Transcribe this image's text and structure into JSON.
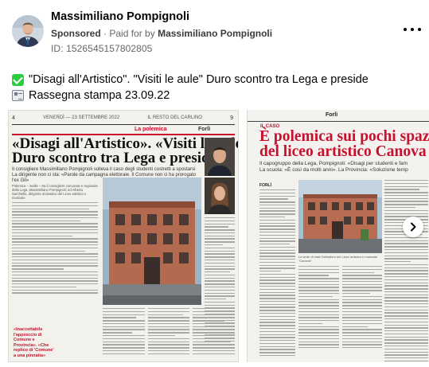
{
  "post": {
    "author": "Massimiliano Pompignoli",
    "sponsored_label": "Sponsored",
    "separator": "·",
    "paid_for_label": "Paid for by",
    "paid_for_name": "Massimiliano Pompignoli",
    "id_label": "ID:",
    "id_value": "1526545157802805",
    "more_icon": "ellipsis-icon",
    "text_line1": "\"Disagi all'Artistico\". \"Visiti le aule\" Duro scontro tra Lega e preside",
    "text_line2": "Rassegna stampa 23.09.22",
    "line1_icon": "check-mark-emoji-icon",
    "line2_icon": "newspaper-emoji-icon"
  },
  "carousel": {
    "next_icon": "chevron-right-icon",
    "card1": {
      "page_number": "4",
      "masthead_date": "VENERDÌ — 23 SETTEMBRE 2022",
      "masthead_paper": "IL RESTO DEL CARLINO",
      "page_corner": "9",
      "section": "La polemica",
      "city": "Forlì",
      "headline_line1": "«Disagi all'Artistico». «Visiti le aule»",
      "headline_line2": "Duro scontro tra Lega e preside",
      "subhead_line1": "Il consigliere Massimiliano Pompignoli sollevа il caso degli studenti costretti a spostarsi",
      "subhead_line2": "La dirigente non ci sta: «Parole da campagna elettorale. Il Comune non ci ha prorogato l'ex Gil»",
      "body_intro": "Polemica – inutile – tra il consigliere comunale e regionale della Lega, Massimiliano Pompignoli, ed Alberta Sarchiello, dirigente scolastico del Liceo artistico e musicale.",
      "pull_quote": "«Inaccettabile l'approccio di Comune e Provincia». «Che replico di 'Comune' a una pinnatia»"
    },
    "card2": {
      "city": "Forlì",
      "section": "IL CASO",
      "headline_line1": "È polemica sui pochi spaz",
      "headline_line2": "del liceo artistico Canova",
      "subhead_line1": "Il capogruppo della Lega, Pompignoli: «Disagi per studenti e fam",
      "subhead_line2": "La scuola: «È così da molti anni». La Provincia: «Soluzione temp",
      "photo_caption": "La sede di viale Salinatore del Liceo artistico e musicale \"Canova\"",
      "column_label": "FORLÌ"
    }
  }
}
